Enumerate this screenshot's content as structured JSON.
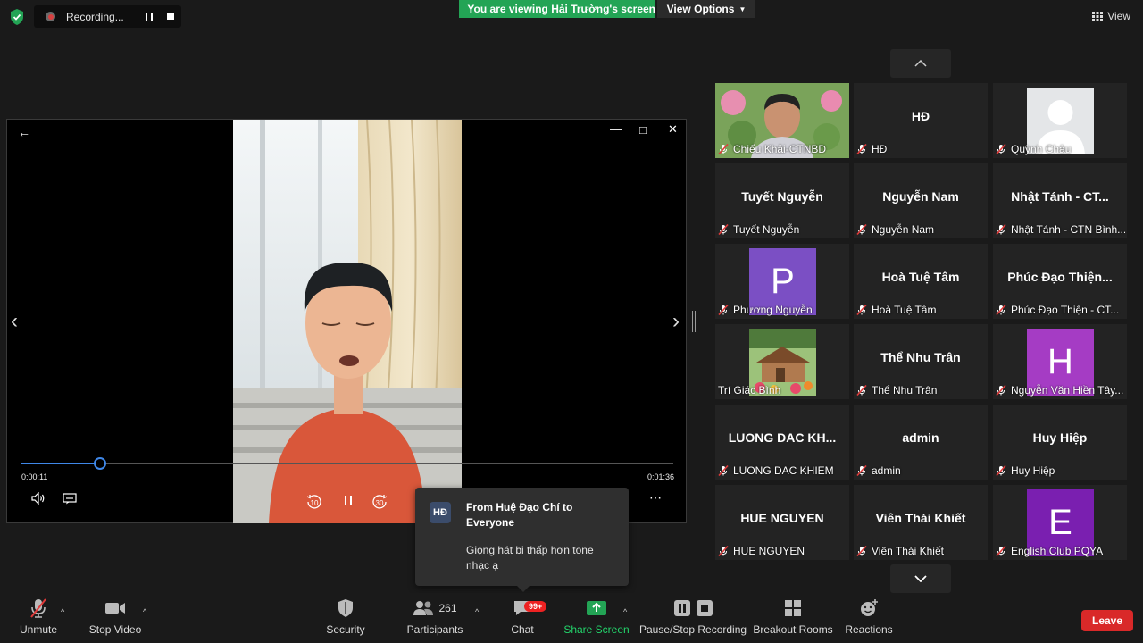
{
  "top": {
    "recording_label": "Recording...",
    "viewing_banner": "You are viewing Hải Trường's screen",
    "view_options": "View Options",
    "view_label": "View"
  },
  "video": {
    "current_time": "0:00:11",
    "total_time": "0:01:36",
    "progress": 0.12,
    "rewind_label": "10",
    "forward_label": "30"
  },
  "chat_popup": {
    "avatar": "HĐ",
    "from": "From Huệ Đạo Chí to Everyone",
    "message": "Giọng hát bị thấp hơn tone nhạc ạ"
  },
  "participants": [
    {
      "big": "",
      "label": "Chiếu Khải-CTNBD",
      "muted": true,
      "kind": "photo-lotus"
    },
    {
      "big": "HĐ",
      "label": "HĐ",
      "muted": true,
      "kind": "text"
    },
    {
      "big": "",
      "label": "Quỳnh Châu",
      "muted": true,
      "kind": "silhouette"
    },
    {
      "big": "Tuyết Nguyễn",
      "label": "Tuyết Nguyễn",
      "muted": true,
      "kind": "text"
    },
    {
      "big": "Nguyễn Nam",
      "label": "Nguyễn Nam",
      "muted": true,
      "kind": "text"
    },
    {
      "big": "Nhật Tánh - CT...",
      "label": "Nhật Tánh - CTN Bình...",
      "muted": true,
      "kind": "text"
    },
    {
      "big": "P",
      "label": "Phương Nguyễn",
      "muted": true,
      "kind": "letter",
      "color": "#7b4fc4"
    },
    {
      "big": "Hoà Tuệ Tâm",
      "label": "Hoà Tuệ Tâm",
      "muted": true,
      "kind": "text"
    },
    {
      "big": "Phúc Đạo Thiện...",
      "label": "Phúc Đạo Thiện - CT...",
      "muted": true,
      "kind": "text"
    },
    {
      "big": "",
      "label": "Trí Giác Bình",
      "muted": false,
      "kind": "photo-house"
    },
    {
      "big": "Thể Nhu Trân",
      "label": "Thể Nhu Trân",
      "muted": true,
      "kind": "text"
    },
    {
      "big": "H",
      "label": "Nguyễn Văn Hiền Tây...",
      "muted": true,
      "kind": "letter",
      "color": "#a53cc4"
    },
    {
      "big": "LUONG DAC KH...",
      "label": "LUONG DAC KHIEM",
      "muted": true,
      "kind": "text"
    },
    {
      "big": "admin",
      "label": "admin",
      "muted": true,
      "kind": "text"
    },
    {
      "big": "Huy Hiệp",
      "label": "Huy Hiệp",
      "muted": true,
      "kind": "text"
    },
    {
      "big": "HUE NGUYEN",
      "label": "HUE NGUYEN",
      "muted": true,
      "kind": "text"
    },
    {
      "big": "Viên Thái Khiết",
      "label": "Viên Thái Khiết",
      "muted": true,
      "kind": "text"
    },
    {
      "big": "E",
      "label": "English Club PQYA",
      "muted": true,
      "kind": "letter",
      "color": "#7a1fb0"
    }
  ],
  "toolbar": {
    "unmute": "Unmute",
    "stop_video": "Stop Video",
    "security": "Security",
    "participants": "Participants",
    "participant_count": "261",
    "chat": "Chat",
    "chat_badge": "99+",
    "share_screen": "Share Screen",
    "pause_recording": "Pause/Stop Recording",
    "breakout_rooms": "Breakout Rooms",
    "reactions": "Reactions",
    "leave": "Leave"
  },
  "colors": {
    "share_green": "#23a455",
    "leave_red": "#d92929",
    "progress_blue": "#3f87e8",
    "mute_red": "#e03a3a"
  }
}
